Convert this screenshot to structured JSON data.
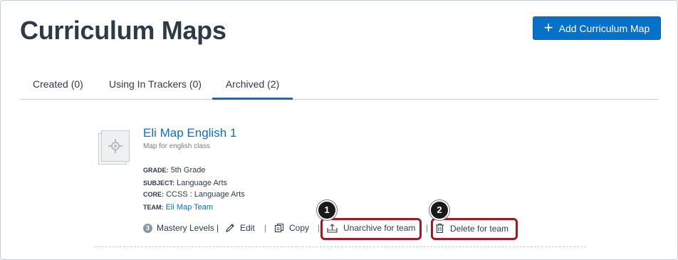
{
  "header": {
    "title": "Curriculum Maps",
    "add_button_label": "Add Curriculum Map",
    "add_icon": "plus-icon"
  },
  "tabs": [
    {
      "label": "Created (0)",
      "active": false
    },
    {
      "label": "Using In Trackers (0)",
      "active": false
    },
    {
      "label": "Archived (2)",
      "active": true
    }
  ],
  "map": {
    "title": "Eli Map English 1",
    "description": "Map for english class",
    "thumbnail_icon": "map-placeholder-icon",
    "meta": [
      {
        "key": "GRADE:",
        "value": "5th Grade"
      },
      {
        "key": "SUBJECT:",
        "value": "Language Arts"
      },
      {
        "key": "CORE:",
        "value": "CCSS : Language Arts"
      },
      {
        "key": "TEAM:",
        "value": "Eli Map Team"
      }
    ],
    "actions": {
      "mastery_count": "3",
      "mastery_label": "Mastery Levels |",
      "edit_label": "Edit",
      "copy_label": "Copy",
      "unarchive_label": "Unarchive for team",
      "delete_label": "Delete for team",
      "separator": "|"
    }
  },
  "callouts": [
    "1",
    "2"
  ],
  "colors": {
    "accent": "#0770c9",
    "highlight": "#9b1c24",
    "text": "#2d3b45"
  }
}
